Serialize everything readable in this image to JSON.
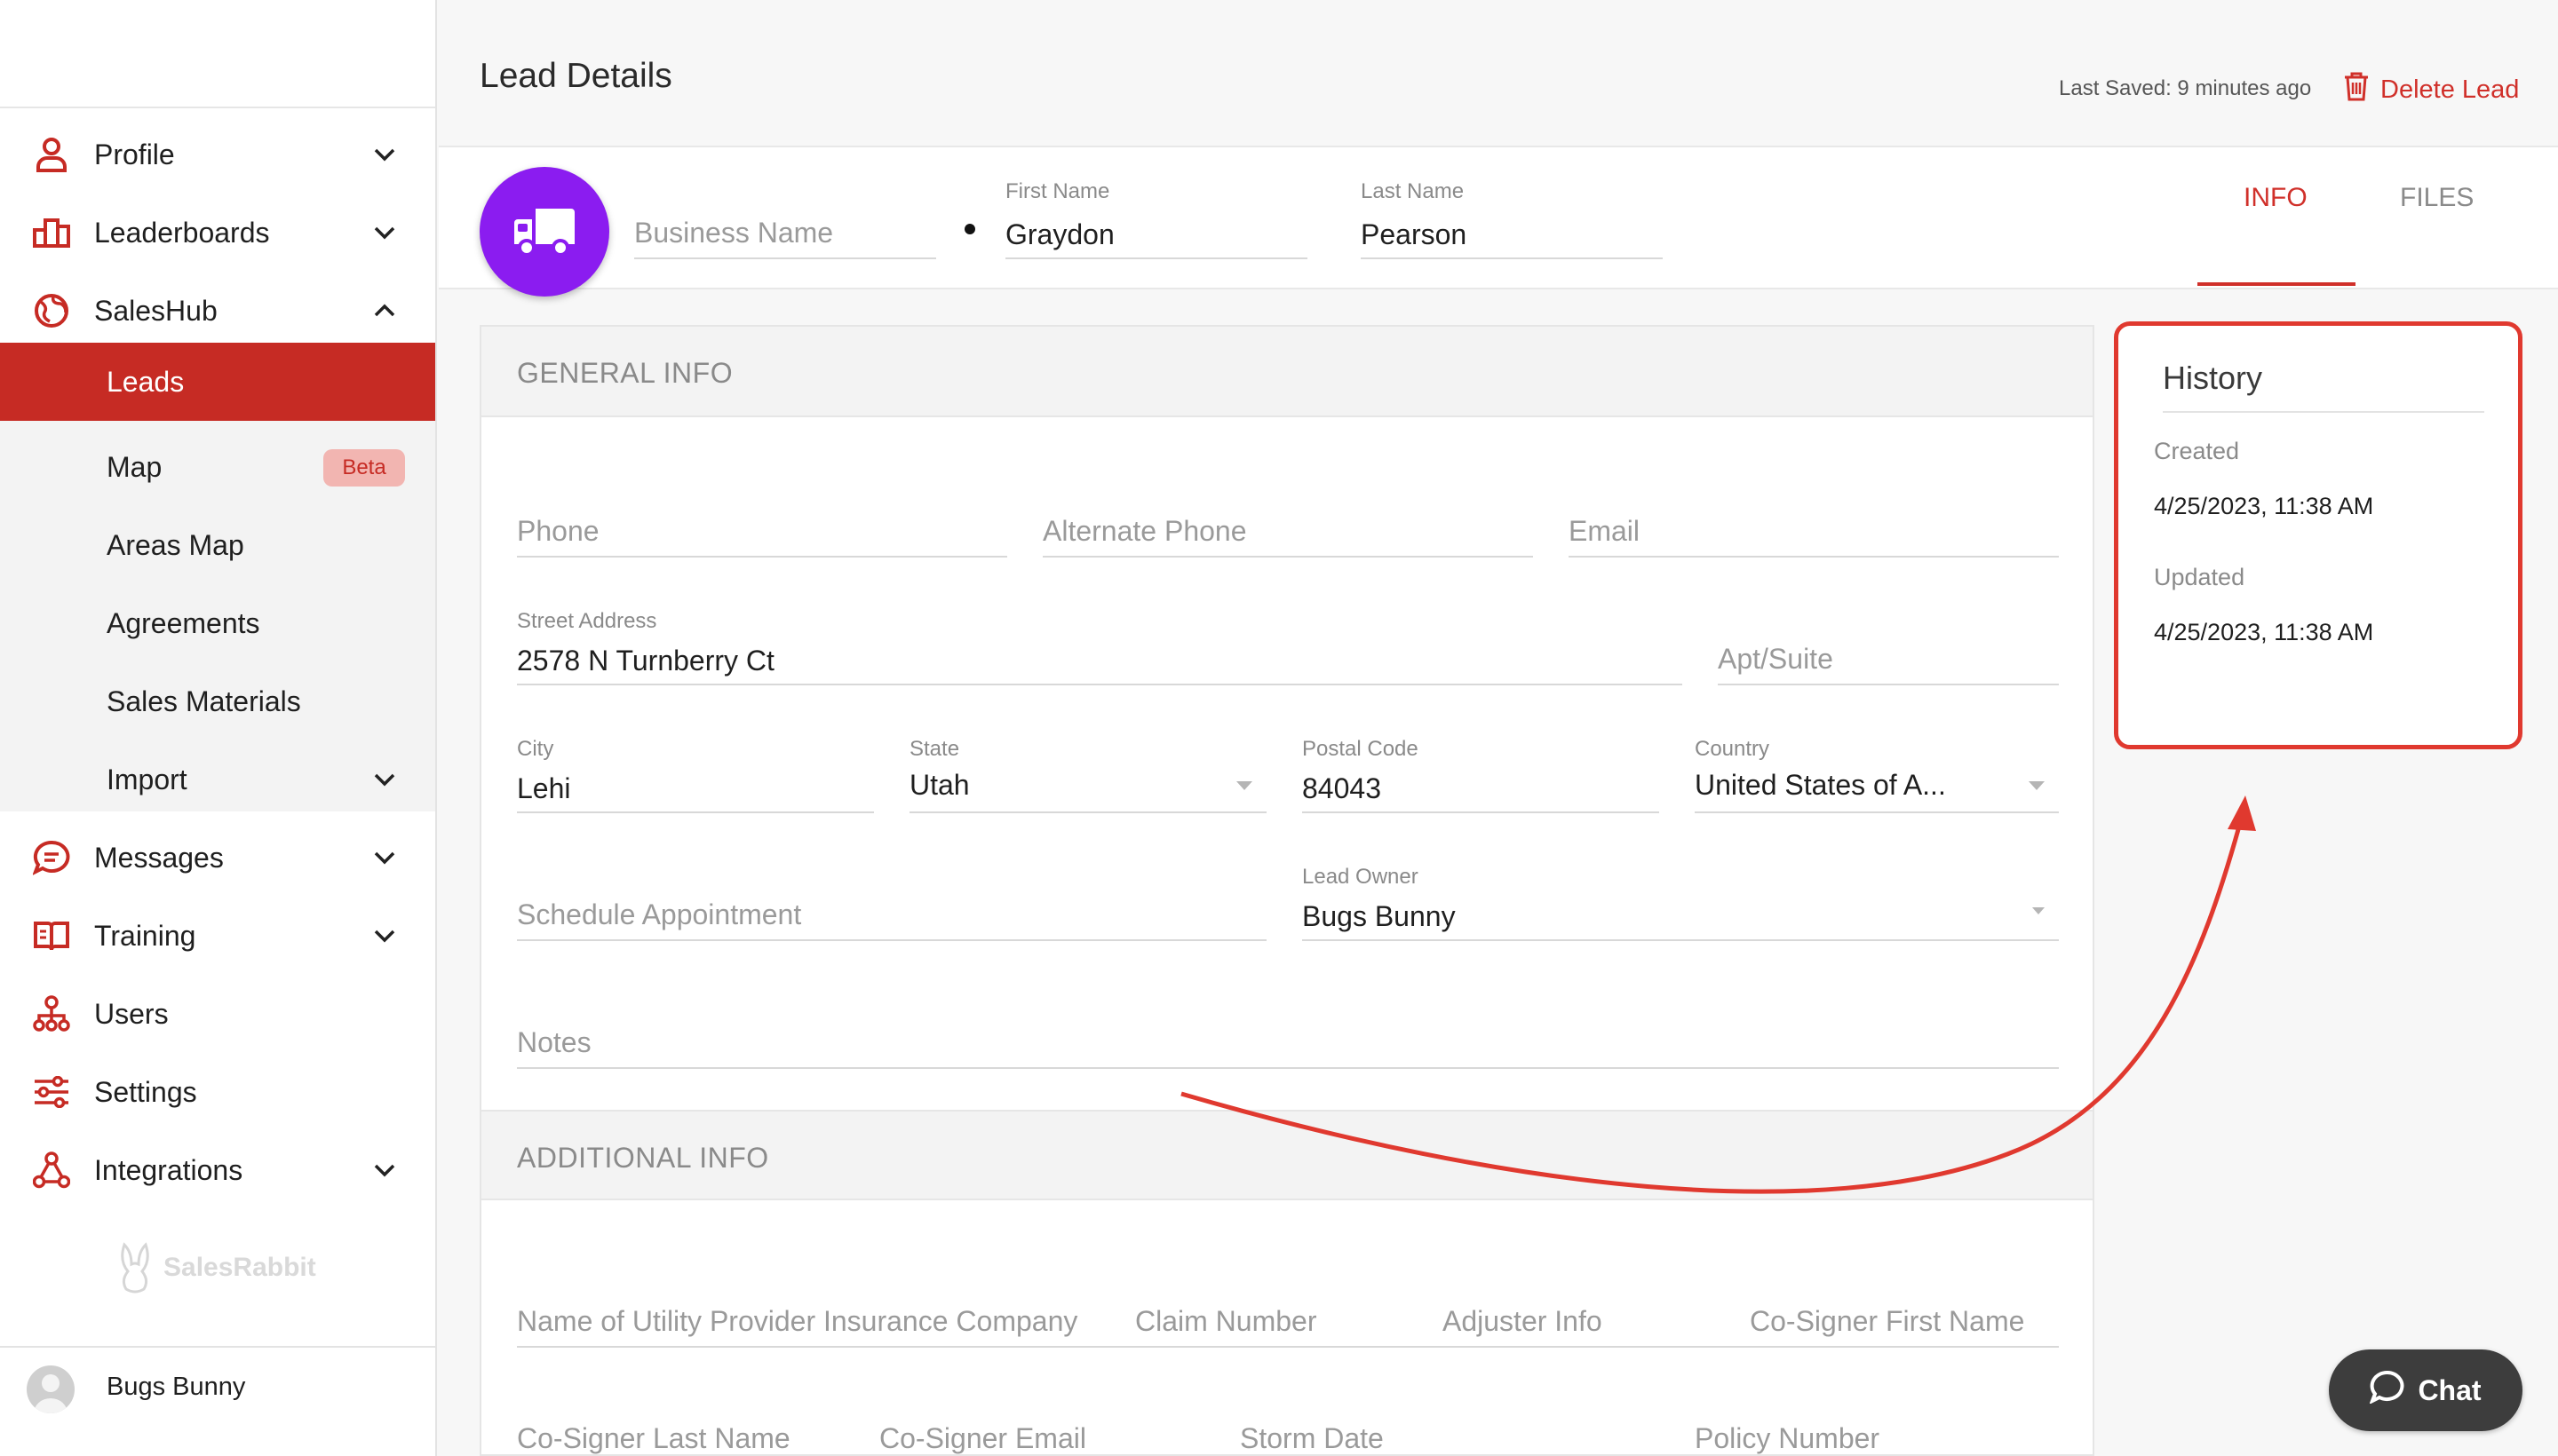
{
  "sidebar": {
    "items": [
      {
        "label": "Profile",
        "icon": "person-icon"
      },
      {
        "label": "Leaderboards",
        "icon": "podium-icon"
      },
      {
        "label": "SalesHub",
        "icon": "globe-icon"
      },
      {
        "label": "Messages",
        "icon": "chat-bubble-icon"
      },
      {
        "label": "Training",
        "icon": "book-icon"
      },
      {
        "label": "Users",
        "icon": "org-chart-icon"
      },
      {
        "label": "Settings",
        "icon": "sliders-icon"
      },
      {
        "label": "Integrations",
        "icon": "network-icon"
      }
    ],
    "subitems": [
      {
        "label": "Leads"
      },
      {
        "label": "Map",
        "badge": "Beta"
      },
      {
        "label": "Areas Map"
      },
      {
        "label": "Agreements"
      },
      {
        "label": "Sales Materials"
      },
      {
        "label": "Import"
      }
    ],
    "brand": "SalesRabbit",
    "user_name": "Bugs Bunny",
    "accent": "#c62b24"
  },
  "header": {
    "title": "Lead Details",
    "last_saved_label": "Last Saved:",
    "last_saved_value": "9 minutes ago",
    "delete_label": "Delete Lead"
  },
  "lead": {
    "business_name_placeholder": "Business Name",
    "first_name_label": "First Name",
    "first_name": "Graydon",
    "last_name_label": "Last Name",
    "last_name": "Pearson",
    "avatar_icon": "truck-icon",
    "avatar_color": "#8b1cf0"
  },
  "tabs": {
    "info": "INFO",
    "files": "FILES"
  },
  "general": {
    "section_title": "GENERAL INFO",
    "phone_placeholder": "Phone",
    "alt_phone_placeholder": "Alternate Phone",
    "email_placeholder": "Email",
    "street_label": "Street Address",
    "street_value": "2578 N Turnberry Ct",
    "apt_placeholder": "Apt/Suite",
    "city_label": "City",
    "city_value": "Lehi",
    "state_label": "State",
    "state_value": "Utah",
    "postal_label": "Postal Code",
    "postal_value": "84043",
    "country_label": "Country",
    "country_value": "United States of A...",
    "schedule_placeholder": "Schedule Appointment",
    "owner_label": "Lead Owner",
    "owner_value": "Bugs Bunny",
    "notes_placeholder": "Notes"
  },
  "additional": {
    "section_title": "ADDITIONAL INFO",
    "row1": [
      "Name of Utility Provider Insurance Company",
      "Claim Number",
      "Adjuster Info",
      "Co-Signer First Name"
    ],
    "row2": [
      "Co-Signer Last Name",
      "Co-Signer Email",
      "Storm Date",
      "Policy Number"
    ]
  },
  "history": {
    "title": "History",
    "created_label": "Created",
    "created_value": "4/25/2023, 11:38 AM",
    "updated_label": "Updated",
    "updated_value": "4/25/2023, 11:38 AM",
    "highlight_color": "#e0392f"
  },
  "chat": {
    "label": "Chat"
  }
}
